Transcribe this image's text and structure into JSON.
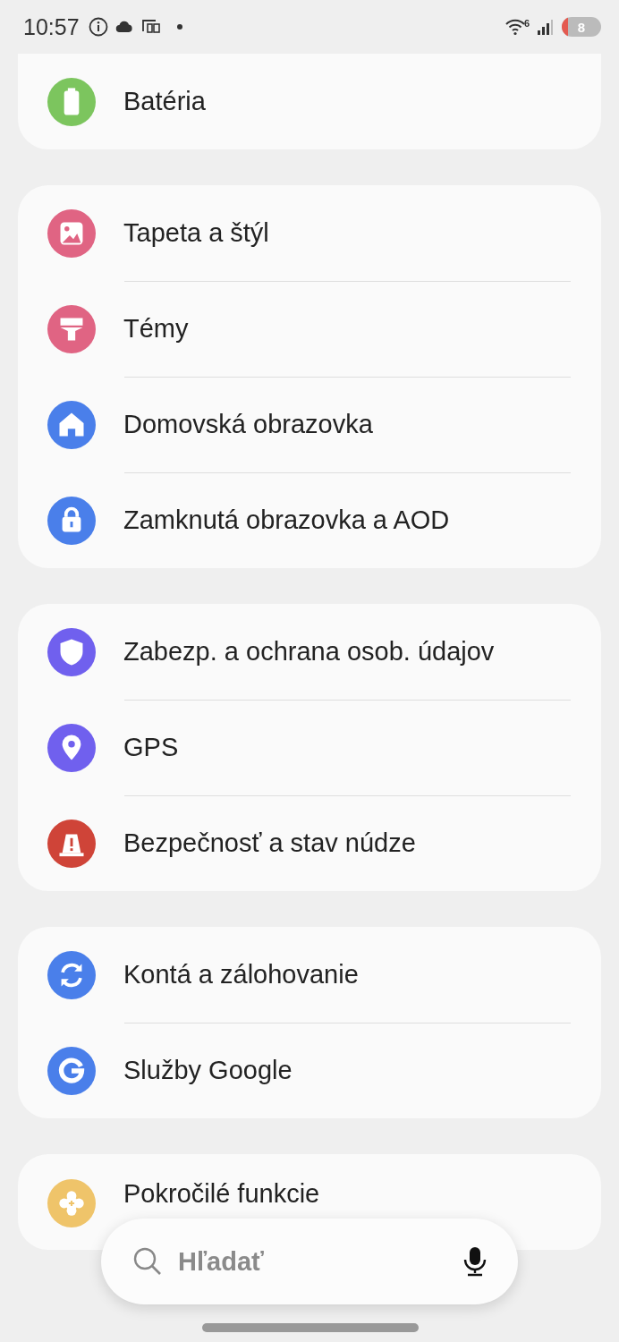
{
  "status_bar": {
    "time": "10:57",
    "wifi_badge": "6",
    "battery": "8"
  },
  "groups": [
    {
      "items": [
        {
          "label": "Batéria",
          "kind": "battery",
          "color": "#7cc55e"
        }
      ]
    },
    {
      "items": [
        {
          "label": "Tapeta a štýl",
          "kind": "picture",
          "color": "#e06483"
        },
        {
          "label": "Témy",
          "kind": "brush",
          "color": "#e06483"
        },
        {
          "label": "Domovská obrazovka",
          "kind": "home",
          "color": "#4a7fea"
        },
        {
          "label": "Zamknutá obrazovka a AOD",
          "kind": "lock",
          "color": "#4a7fea"
        }
      ]
    },
    {
      "items": [
        {
          "label": "Zabezp. a ochrana osob. údajov",
          "kind": "shield",
          "color": "#7060ee"
        },
        {
          "label": "GPS",
          "kind": "pin",
          "color": "#7060ee"
        },
        {
          "label": "Bezpečnosť a stav núdze",
          "kind": "alert",
          "color": "#cf4438"
        }
      ]
    },
    {
      "items": [
        {
          "label": "Kontá a zálohovanie",
          "kind": "sync",
          "color": "#4a7fea"
        },
        {
          "label": "Služby Google",
          "kind": "g",
          "color": "#4a7fea"
        }
      ]
    },
    {
      "items": [
        {
          "label": "Pokročilé funkcie",
          "kind": "gear",
          "color": "#efc46a"
        }
      ]
    }
  ],
  "search": {
    "placeholder": "Hľadať"
  }
}
